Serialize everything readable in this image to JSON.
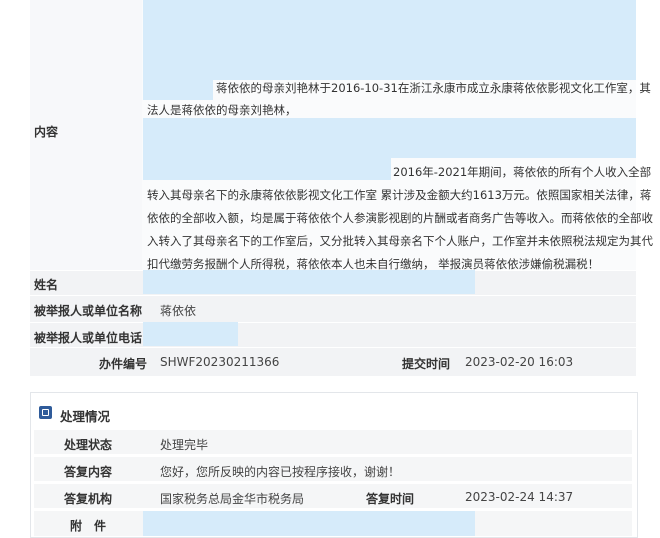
{
  "report": {
    "content_label": "内容",
    "content_para1_lines": [
      "蒋依依的母亲刘艳林于2016-10-31在浙江永康市成立永康蒋依依影视文化工作室，其",
      "法人是蒋依依的母亲刘艳林，"
    ],
    "content_para2_lines": [
      "2016年-2021年期间，蒋依依的所有个人收入全部",
      "转入其母亲名下的永康蒋依依影视文化工作室 累计涉及金额大约1613万元。依照国家相关法律，蒋",
      "依依的全部收入额，均是属于蒋依依个人参演影视剧的片酬或者商务广告等收入。而蒋依依的全部收",
      "入转入了其母亲名下的工作室后，又分批转入其母亲名下个人账户，工作室并未依照税法规定为其代",
      "扣代缴劳务报酬个人所得税，蒋依依本人也未自行缴纳，     举报演员蒋依依涉嫌偷税漏税！"
    ],
    "name_label": "姓名",
    "reported_name_label": "被举报人或单位名称",
    "reported_name_value": "蒋依依",
    "reported_phone_label": "被举报人或单位电话",
    "case_no_label": "办件编号",
    "case_no_value": "SHWF20230211366",
    "submit_time_label": "提交时间",
    "submit_time_value": "2023-02-20 16:03"
  },
  "processing": {
    "title": "处理情况",
    "status_label": "处理状态",
    "status_value": "处理完毕",
    "reply_content_label": "答复内容",
    "reply_content_value": "您好，您所反映的内容已按程序接收，谢谢！",
    "reply_org_label": "答复机构",
    "reply_org_value": "国家税务总局金华市税务局",
    "reply_time_label": "答复时间",
    "reply_time_value": "2023-02-24 14:37",
    "attachment_label": "附　件"
  },
  "colors": {
    "highlight": "#d6ebfa",
    "label_bg": "#f2f3f5",
    "icon_bg": "#2f5b9a"
  }
}
